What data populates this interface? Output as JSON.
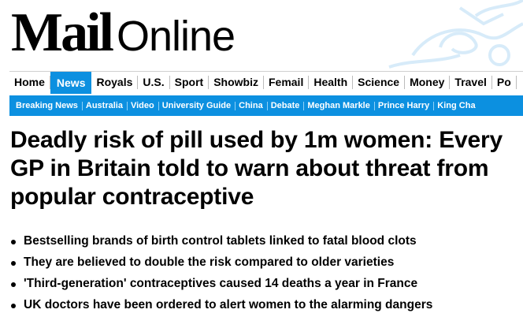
{
  "site": {
    "logo_mail": "Mail",
    "logo_online": "Online"
  },
  "nav_primary": [
    "Home",
    "News",
    "Royals",
    "U.S.",
    "Sport",
    "Showbiz",
    "Femail",
    "Health",
    "Science",
    "Money",
    "Travel",
    "Po"
  ],
  "nav_primary_active": "News",
  "nav_secondary": [
    "Breaking News",
    "Australia",
    "Video",
    "University Guide",
    "China",
    "Debate",
    "Meghan Markle",
    "Prince Harry",
    "King Cha"
  ],
  "article": {
    "headline": "Deadly risk of pill used by 1m women: Every GP in Britain told to warn about threat from popular contraceptive",
    "bullets": [
      "Bestselling brands of birth control tablets linked to fatal blood clots",
      "They are believed to double the risk compared to older varieties",
      "'Third-generation' contraceptives caused 14 deaths a year in France",
      "UK doctors have been ordered to alert women to the alarming dangers"
    ]
  },
  "colors": {
    "accent": "#0c90e0",
    "text": "#000000",
    "deco": "#d7ebf9"
  }
}
